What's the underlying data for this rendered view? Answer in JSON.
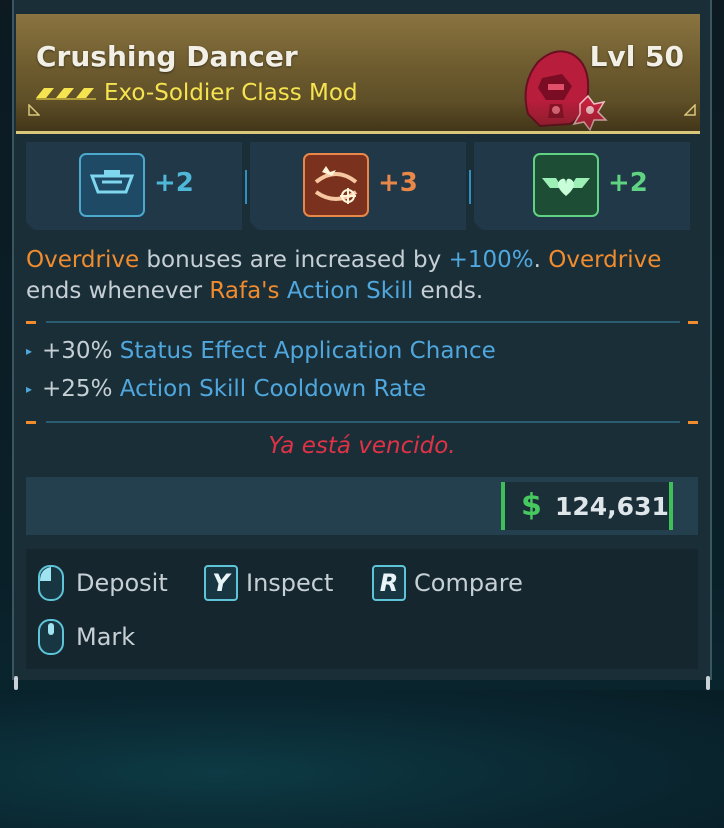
{
  "item": {
    "name": "Crushing Dancer",
    "level": "Lvl 50",
    "type": "Exo-Soldier Class Mod",
    "rarity_icon": "rarity-chevrons-icon",
    "class_icon": "exo-soldier-helmet-icon"
  },
  "stats": [
    {
      "icon": "armor-tank-skill-icon",
      "value": "+2",
      "color": "#4fb7d8"
    },
    {
      "icon": "explosive-target-skill-icon",
      "value": "+3",
      "color": "#e8874a"
    },
    {
      "icon": "heart-heal-skill-icon",
      "value": "+2",
      "color": "#5fd382"
    }
  ],
  "description": {
    "part1": "Overdrive",
    "part2": " bonuses are increased by ",
    "part3": "+100%",
    "part4": ". ",
    "part5": "Overdrive",
    "part6": "ends whenever ",
    "part7": "Rafa's",
    "part8": " ",
    "part9": "Action Skill",
    "part10": " ends."
  },
  "perks": [
    {
      "amount": "+30%",
      "label": "Status Effect Application Chance"
    },
    {
      "amount": "+25%",
      "label": "Action Skill Cooldown Rate"
    }
  ],
  "expired_text": "Ya está vencido.",
  "price": {
    "symbol": "$",
    "value": "124,631"
  },
  "actions": {
    "deposit": {
      "label": "Deposit",
      "key_icon": "mouse-left-icon"
    },
    "inspect": {
      "label": "Inspect",
      "key": "Y"
    },
    "compare": {
      "label": "Compare",
      "key": "R"
    },
    "mark": {
      "label": "Mark",
      "key_icon": "mouse-middle-icon"
    }
  },
  "colors": {
    "header_gold": "#8a7440",
    "rarity_yellow": "#f5e34f",
    "accent_orange": "#f08b2e",
    "accent_blue": "#4fa7dd",
    "expired_red": "#e03247",
    "money_green": "#47c95f"
  }
}
